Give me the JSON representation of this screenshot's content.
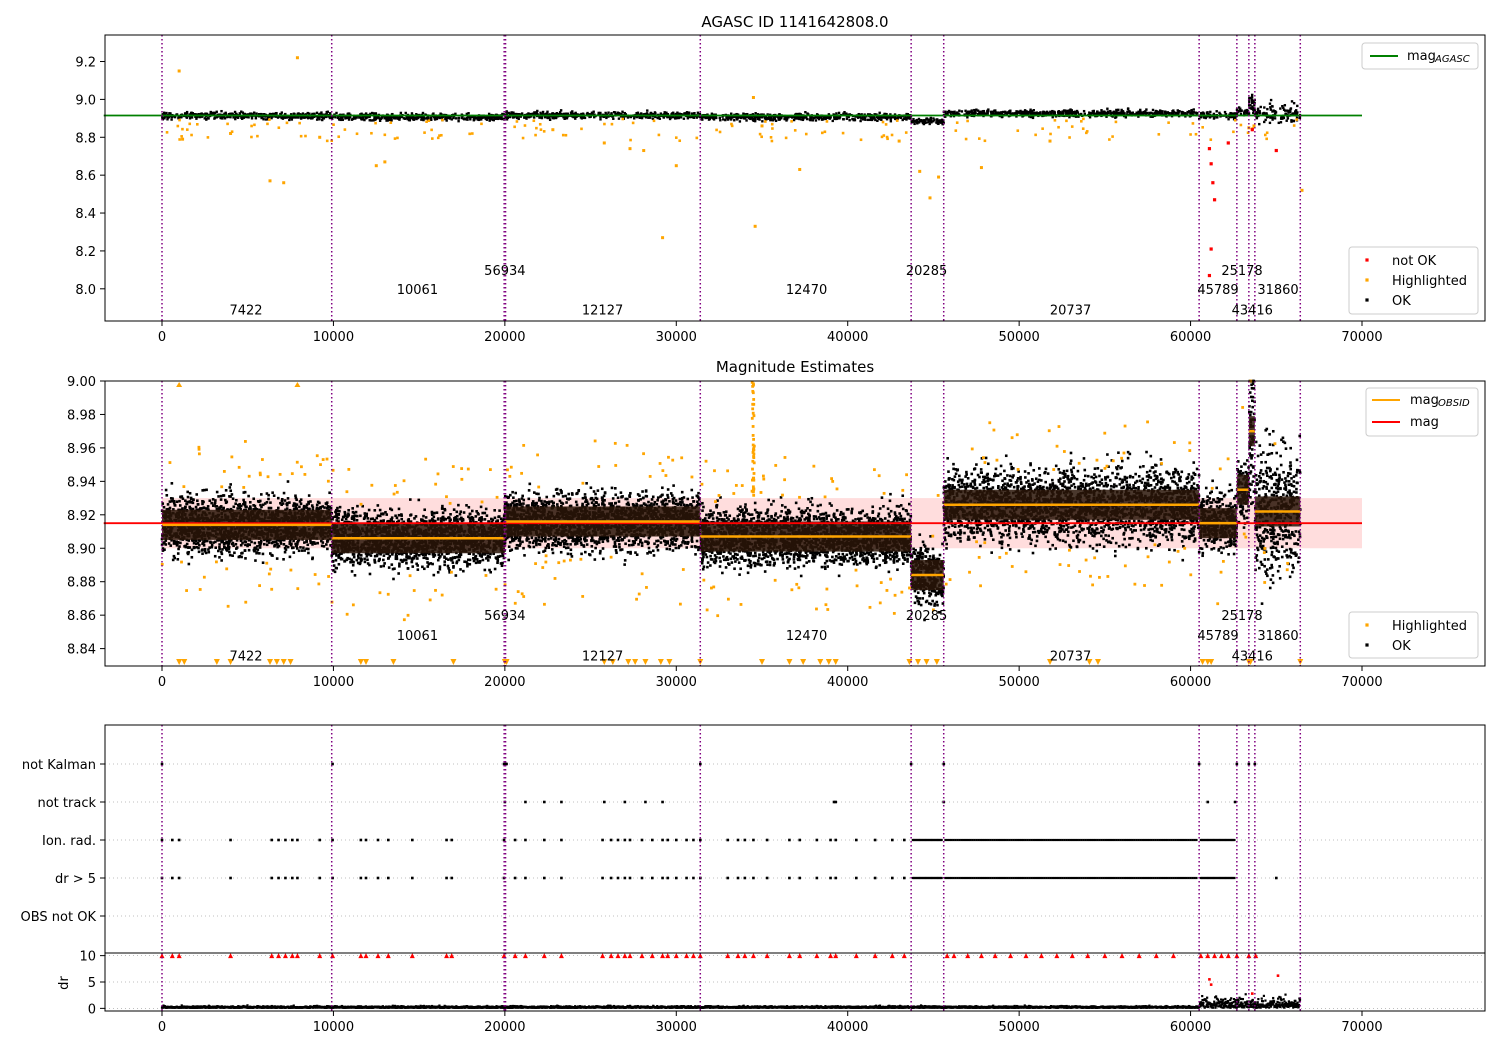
{
  "chart_data": [
    {
      "type": "scatter",
      "title": "AGASC ID 1141642808.0",
      "xlim": [
        -3400,
        76800
      ],
      "ylim": [
        7.83,
        9.34
      ],
      "xticks": [
        "0",
        "10000",
        "20000",
        "30000",
        "40000",
        "50000",
        "60000",
        "70000"
      ],
      "yticks": [
        "8.0",
        "8.2",
        "8.4",
        "8.6",
        "8.8",
        "9.0",
        "9.2"
      ],
      "legend_top": {
        "position": "upper right",
        "entries": [
          {
            "label": "mag",
            "sub": "AGASC",
            "color": "#008000",
            "kind": "line"
          }
        ]
      },
      "legend_bottom": {
        "position": "lower right",
        "entries": [
          {
            "label": "not OK",
            "color": "#ff0000",
            "kind": "dot"
          },
          {
            "label": "Highlighted",
            "color": "#ffa500",
            "kind": "dot"
          },
          {
            "label": "OK",
            "color": "#000000",
            "kind": "dot"
          }
        ]
      },
      "reference_line": {
        "value": 8.915,
        "x_range": [
          -3400,
          70000
        ],
        "color": "#008000"
      },
      "obsid_boundaries": [
        0,
        9900,
        19960,
        20040,
        31400,
        43700,
        45600,
        60500,
        62700,
        63400,
        63750,
        66400
      ],
      "obsid_labels": [
        {
          "text": "7422",
          "x": 4900,
          "y": 7.89
        },
        {
          "text": "10061",
          "x": 14900,
          "y": 8.0
        },
        {
          "text": "56934",
          "x": 20000,
          "y": 8.1
        },
        {
          "text": "12127",
          "x": 25700,
          "y": 7.89
        },
        {
          "text": "12470",
          "x": 37600,
          "y": 8.0
        },
        {
          "text": "20285",
          "x": 44600,
          "y": 8.1
        },
        {
          "text": "20737",
          "x": 53000,
          "y": 7.89
        },
        {
          "text": "45789",
          "x": 61600,
          "y": 8.0
        },
        {
          "text": "25178",
          "x": 63000,
          "y": 8.1
        },
        {
          "text": "43416",
          "x": 63600,
          "y": 7.89
        },
        {
          "text": "31860",
          "x": 65100,
          "y": 8.0
        }
      ],
      "segments": [
        {
          "x": [
            0,
            9900
          ],
          "level": 8.914
        },
        {
          "x": [
            9900,
            20000
          ],
          "level": 8.906
        },
        {
          "x": [
            20000,
            31400
          ],
          "level": 8.916
        },
        {
          "x": [
            31400,
            43700
          ],
          "level": 8.907
        },
        {
          "x": [
            43700,
            45600
          ],
          "level": 8.884
        },
        {
          "x": [
            45600,
            60500
          ],
          "level": 8.926
        },
        {
          "x": [
            60500,
            62700
          ],
          "level": 8.915
        },
        {
          "x": [
            62700,
            63400
          ],
          "level": 8.935
        },
        {
          "x": [
            63400,
            63750
          ],
          "level": 8.97
        },
        {
          "x": [
            63750,
            66400
          ],
          "level": 8.922
        }
      ],
      "highlighted_points": [
        [
          1000,
          9.15
        ],
        [
          7900,
          9.22
        ],
        [
          6300,
          8.57
        ],
        [
          7100,
          8.56
        ],
        [
          12500,
          8.65
        ],
        [
          13000,
          8.67
        ],
        [
          29200,
          8.27
        ],
        [
          34600,
          8.33
        ],
        [
          34500,
          9.01
        ],
        [
          37200,
          8.63
        ],
        [
          43000,
          8.78
        ],
        [
          44200,
          8.62
        ],
        [
          45300,
          8.59
        ],
        [
          44800,
          8.48
        ],
        [
          47800,
          8.64
        ],
        [
          51800,
          8.78
        ],
        [
          25800,
          8.77
        ],
        [
          27300,
          8.74
        ],
        [
          28100,
          8.73
        ],
        [
          30000,
          8.65
        ],
        [
          4000,
          8.82
        ],
        [
          9200,
          8.8
        ],
        [
          63400,
          8.85
        ],
        [
          63700,
          8.86
        ],
        [
          66500,
          8.52
        ],
        [
          1200,
          8.79
        ],
        [
          22800,
          8.84
        ],
        [
          35000,
          8.86
        ]
      ],
      "not_ok_points": [
        [
          61100,
          8.74
        ],
        [
          61200,
          8.66
        ],
        [
          61300,
          8.56
        ],
        [
          61400,
          8.47
        ],
        [
          61200,
          8.21
        ],
        [
          61100,
          8.07
        ],
        [
          62200,
          8.77
        ],
        [
          65000,
          8.73
        ],
        [
          63600,
          8.84
        ]
      ]
    },
    {
      "type": "scatter",
      "title": "Magnitude Estimates",
      "xlim": [
        -3400,
        76800
      ],
      "ylim": [
        8.83,
        9.0
      ],
      "xticks": [
        "0",
        "10000",
        "20000",
        "30000",
        "40000",
        "50000",
        "60000",
        "70000"
      ],
      "yticks": [
        "8.84",
        "8.86",
        "8.88",
        "8.90",
        "8.92",
        "8.94",
        "8.96",
        "8.98",
        "9.00"
      ],
      "legend_top": {
        "position": "upper right",
        "entries": [
          {
            "label": "mag",
            "sub": "OBSID",
            "color": "#ffa500",
            "kind": "line"
          },
          {
            "label": "mag",
            "sub": "",
            "color": "#ff0000",
            "kind": "line"
          }
        ]
      },
      "legend_bottom": {
        "position": "lower right",
        "entries": [
          {
            "label": "Highlighted",
            "color": "#ffa500",
            "kind": "dot"
          },
          {
            "label": "OK",
            "color": "#000000",
            "kind": "dot"
          }
        ]
      },
      "mean_mag": 8.915,
      "band": [
        8.9,
        8.93
      ],
      "obsid_labels": [
        {
          "text": "7422",
          "x": 4900,
          "y": 8.836
        },
        {
          "text": "10061",
          "x": 14900,
          "y": 8.848
        },
        {
          "text": "56934",
          "x": 20000,
          "y": 8.86
        },
        {
          "text": "12127",
          "x": 25700,
          "y": 8.836
        },
        {
          "text": "12470",
          "x": 37600,
          "y": 8.848
        },
        {
          "text": "20285",
          "x": 44600,
          "y": 8.86
        },
        {
          "text": "20737",
          "x": 53000,
          "y": 8.836
        },
        {
          "text": "45789",
          "x": 61600,
          "y": 8.848
        },
        {
          "text": "25178",
          "x": 63000,
          "y": 8.86
        },
        {
          "text": "43416",
          "x": 63600,
          "y": 8.836
        },
        {
          "text": "31860",
          "x": 65100,
          "y": 8.848
        }
      ]
    },
    {
      "type": "scatter",
      "title": "",
      "xlim": [
        -3400,
        76800
      ],
      "xticks": [
        "0",
        "10000",
        "20000",
        "30000",
        "40000",
        "50000",
        "60000",
        "70000"
      ],
      "flag_rows": [
        "not Kalman",
        "not track",
        "Ion. rad.",
        "dr > 5",
        "OBS not OK"
      ],
      "dr_axis": {
        "label": "dr",
        "ylim": [
          -0.5,
          10.5
        ],
        "yticks": [
          "0",
          "5",
          "10"
        ]
      },
      "flag_points": {
        "not Kalman": [
          0,
          9950,
          19950,
          20050,
          20100,
          31400,
          43700,
          45600,
          60500,
          62700,
          63400,
          63750
        ],
        "not track": [
          20000,
          21200,
          22300,
          23300,
          25800,
          27000,
          28200,
          29200,
          39200,
          39300,
          45600,
          61000,
          62600
        ],
        "Ion. rad.": [
          0,
          600,
          1000,
          4000,
          6400,
          6800,
          7200,
          7600,
          7900,
          9200,
          9950,
          11600,
          11900,
          12600,
          13200,
          14600,
          16600,
          16900,
          19950,
          20600,
          21200,
          22300,
          23300,
          25700,
          26200,
          26600,
          27000,
          27300,
          28000,
          28600,
          29200,
          29500,
          30000,
          30600,
          31000,
          31400,
          33000,
          33600,
          34000,
          34500,
          35300,
          36600,
          37200,
          38200,
          39000,
          39300,
          40500,
          41600,
          42600,
          43300
        ],
        "dr > 5": [
          0,
          600,
          1000,
          4000,
          6400,
          6800,
          7200,
          7600,
          7900,
          9200,
          9950,
          11600,
          11900,
          12600,
          13200,
          14600,
          16600,
          16900,
          19950,
          20600,
          21200,
          22300,
          23300,
          25700,
          26200,
          26600,
          27000,
          27300,
          28000,
          28600,
          29200,
          29500,
          30000,
          30600,
          31000,
          31400,
          33000,
          33600,
          34000,
          34500,
          35300,
          36600,
          37200,
          38200,
          39000,
          39300,
          40500,
          41600,
          42600,
          43300,
          65000
        ],
        "OBS not OK": []
      }
    }
  ]
}
